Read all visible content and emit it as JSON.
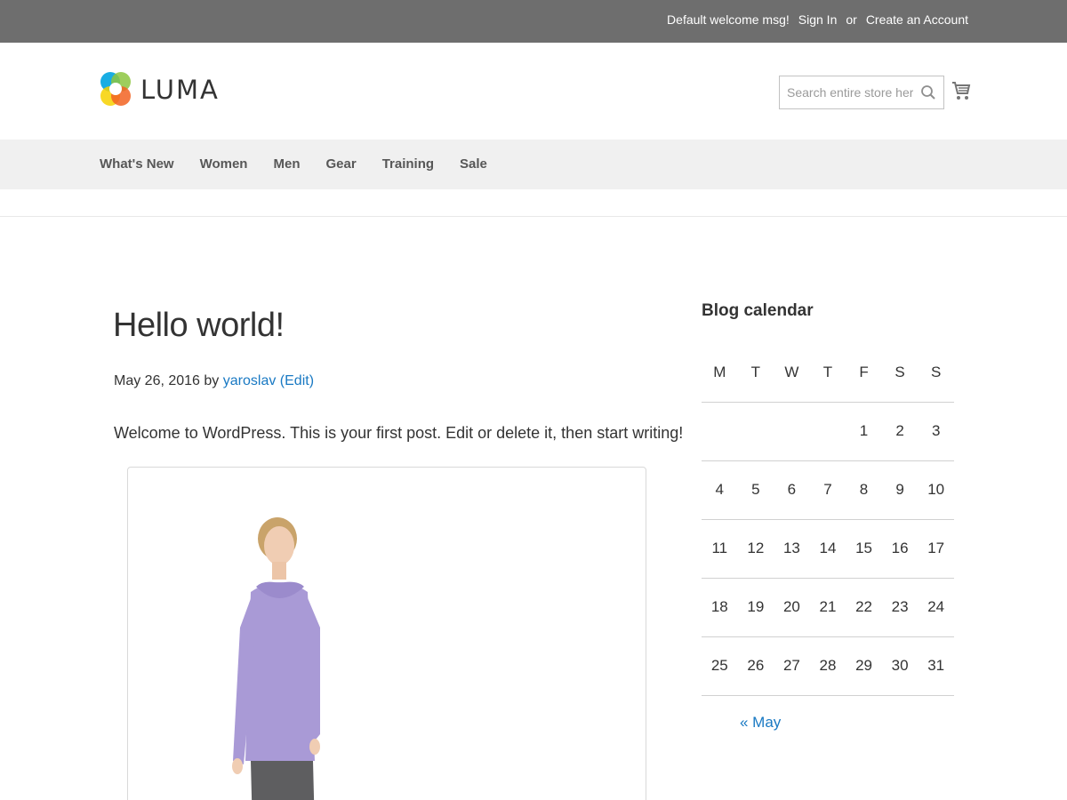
{
  "top_panel": {
    "welcome": "Default welcome msg!",
    "sign_in": "Sign In",
    "or": "or",
    "create_account": "Create an Account"
  },
  "header": {
    "logo_text": "LUMA",
    "search_placeholder": "Search entire store here...",
    "search_icon": "search-icon",
    "cart_icon": "shopping-cart-icon"
  },
  "nav": {
    "items": [
      "What's New",
      "Women",
      "Men",
      "Gear",
      "Training",
      "Sale"
    ]
  },
  "post": {
    "title": "Hello world!",
    "date": "May 26, 2016",
    "by": "by",
    "author": "yaroslav",
    "edit": "(Edit)",
    "body": "Welcome to WordPress. This is your first post. Edit or delete it, then start writing!"
  },
  "sidebar": {
    "calendar_title": "Blog calendar",
    "weekdays": [
      "M",
      "T",
      "W",
      "T",
      "F",
      "S",
      "S"
    ],
    "weeks": [
      [
        "",
        "",
        "",
        "",
        "1",
        "2",
        "3"
      ],
      [
        "4",
        "5",
        "6",
        "7",
        "8",
        "9",
        "10"
      ],
      [
        "11",
        "12",
        "13",
        "14",
        "15",
        "16",
        "17"
      ],
      [
        "18",
        "19",
        "20",
        "21",
        "22",
        "23",
        "24"
      ],
      [
        "25",
        "26",
        "27",
        "28",
        "29",
        "30",
        "31"
      ]
    ],
    "prev_link": "« May"
  },
  "colors": {
    "top_panel_bg": "#6e6e6e",
    "nav_bg": "#f0f0f0",
    "link": "#1979c3",
    "shirt": "#a99ad6"
  }
}
